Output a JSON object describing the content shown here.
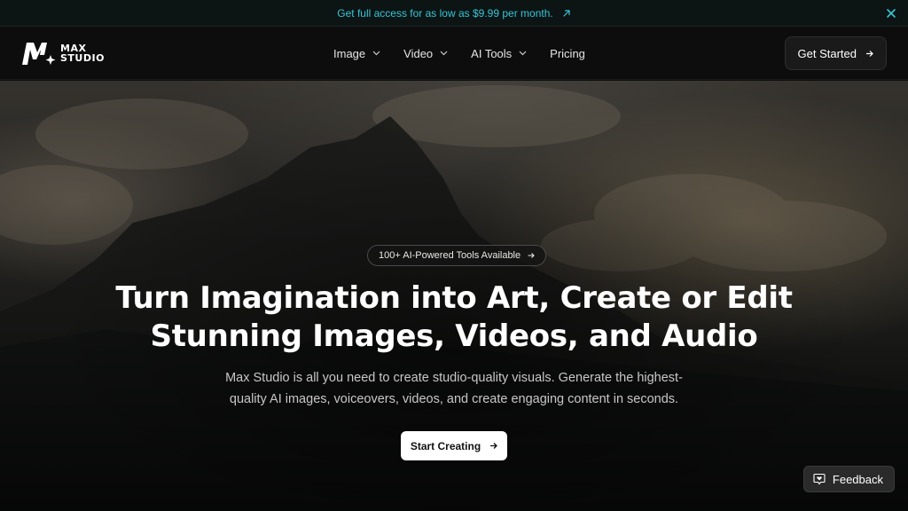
{
  "announcement": {
    "text": "Get full access for as low as $9.99 per month.",
    "link_icon": "arrow-up-right-icon",
    "close_icon": "close-icon",
    "color": "#37c5d6"
  },
  "header": {
    "logo": {
      "line1": "MAX",
      "line2": "STUDIO"
    },
    "nav": [
      {
        "label": "Image",
        "has_dropdown": true
      },
      {
        "label": "Video",
        "has_dropdown": true
      },
      {
        "label": "AI Tools",
        "has_dropdown": true
      },
      {
        "label": "Pricing",
        "has_dropdown": false
      }
    ],
    "cta": {
      "label": "Get Started",
      "icon": "arrow-right-icon"
    }
  },
  "hero": {
    "badge": {
      "label": "100+ AI-Powered Tools Available",
      "icon": "arrow-right-icon"
    },
    "headline": {
      "line1": "Turn Imagination into Art, Create or Edit",
      "line2": "Stunning Images, Videos, and Audio"
    },
    "subheadline": {
      "line1": "Max Studio is all you need to create studio-quality visuals. Generate the highest-",
      "line2": "quality AI images, voiceovers, videos, and create engaging content in seconds."
    },
    "cta": {
      "label": "Start Creating",
      "icon": "arrow-right-icon"
    }
  },
  "feedback": {
    "label": "Feedback",
    "icon": "feedback-heart-icon"
  }
}
